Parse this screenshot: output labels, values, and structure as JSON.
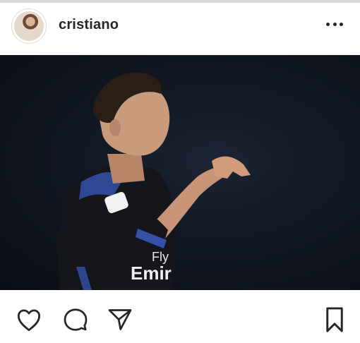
{
  "post": {
    "username": "cristiano",
    "more_icon": "more-horizontal-icon"
  },
  "jersey": {
    "sponsor_line1": "Fly",
    "sponsor_line2": "Emir"
  },
  "actions": {
    "like_icon": "heart-icon",
    "comment_icon": "comment-icon",
    "share_icon": "send-icon",
    "save_icon": "bookmark-icon"
  },
  "colors": {
    "text": "#262626",
    "photo_bg": "#0f141d",
    "jersey": "#14161c",
    "jersey_trim": "#3550a8"
  }
}
